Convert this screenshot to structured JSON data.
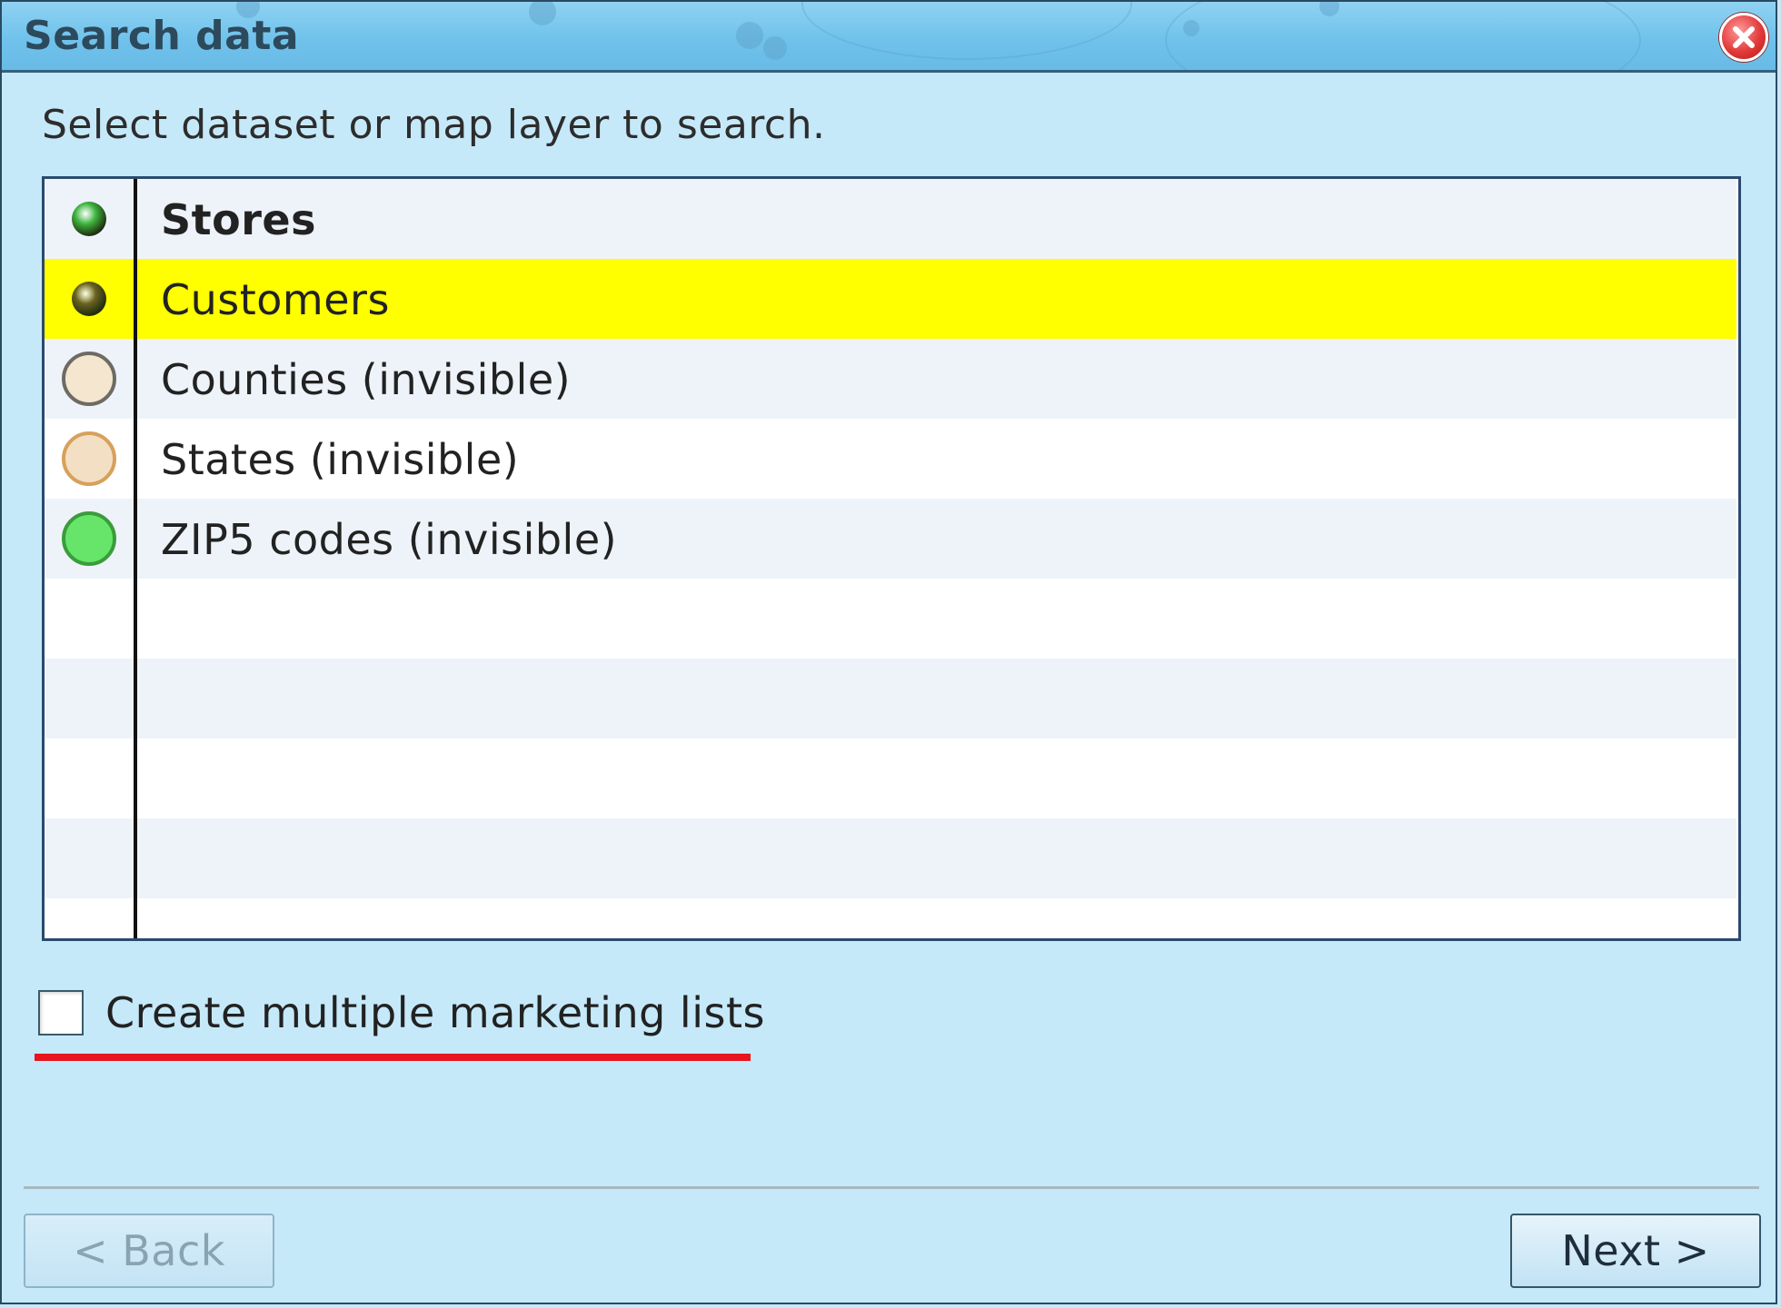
{
  "window": {
    "title": "Search data",
    "close_icon": "close-icon"
  },
  "instruction": "Select dataset or map layer to search.",
  "layers": [
    {
      "label": "Stores",
      "icon": "green-dot-icon",
      "color": "#3fb63f",
      "bold": true,
      "selected": false
    },
    {
      "label": "Customers",
      "icon": "olive-dot-icon",
      "color": "#6b6420",
      "bold": false,
      "selected": true
    },
    {
      "label": "Counties (invisible)",
      "icon": "beige-circle-icon",
      "color": "#f5e6cf",
      "bold": false,
      "selected": false
    },
    {
      "label": "States (invisible)",
      "icon": "tan-circle-icon",
      "color": "#f3e0c4",
      "bold": false,
      "selected": false
    },
    {
      "label": "ZIP5 codes (invisible)",
      "icon": "light-green-circle-icon",
      "color": "#66e56a",
      "bold": false,
      "selected": false
    }
  ],
  "checkbox": {
    "label": "Create multiple marketing lists",
    "checked": false
  },
  "buttons": {
    "back": "< Back",
    "next": "Next >"
  },
  "colors": {
    "selection": "#ffff00",
    "underline": "#e8141e"
  }
}
